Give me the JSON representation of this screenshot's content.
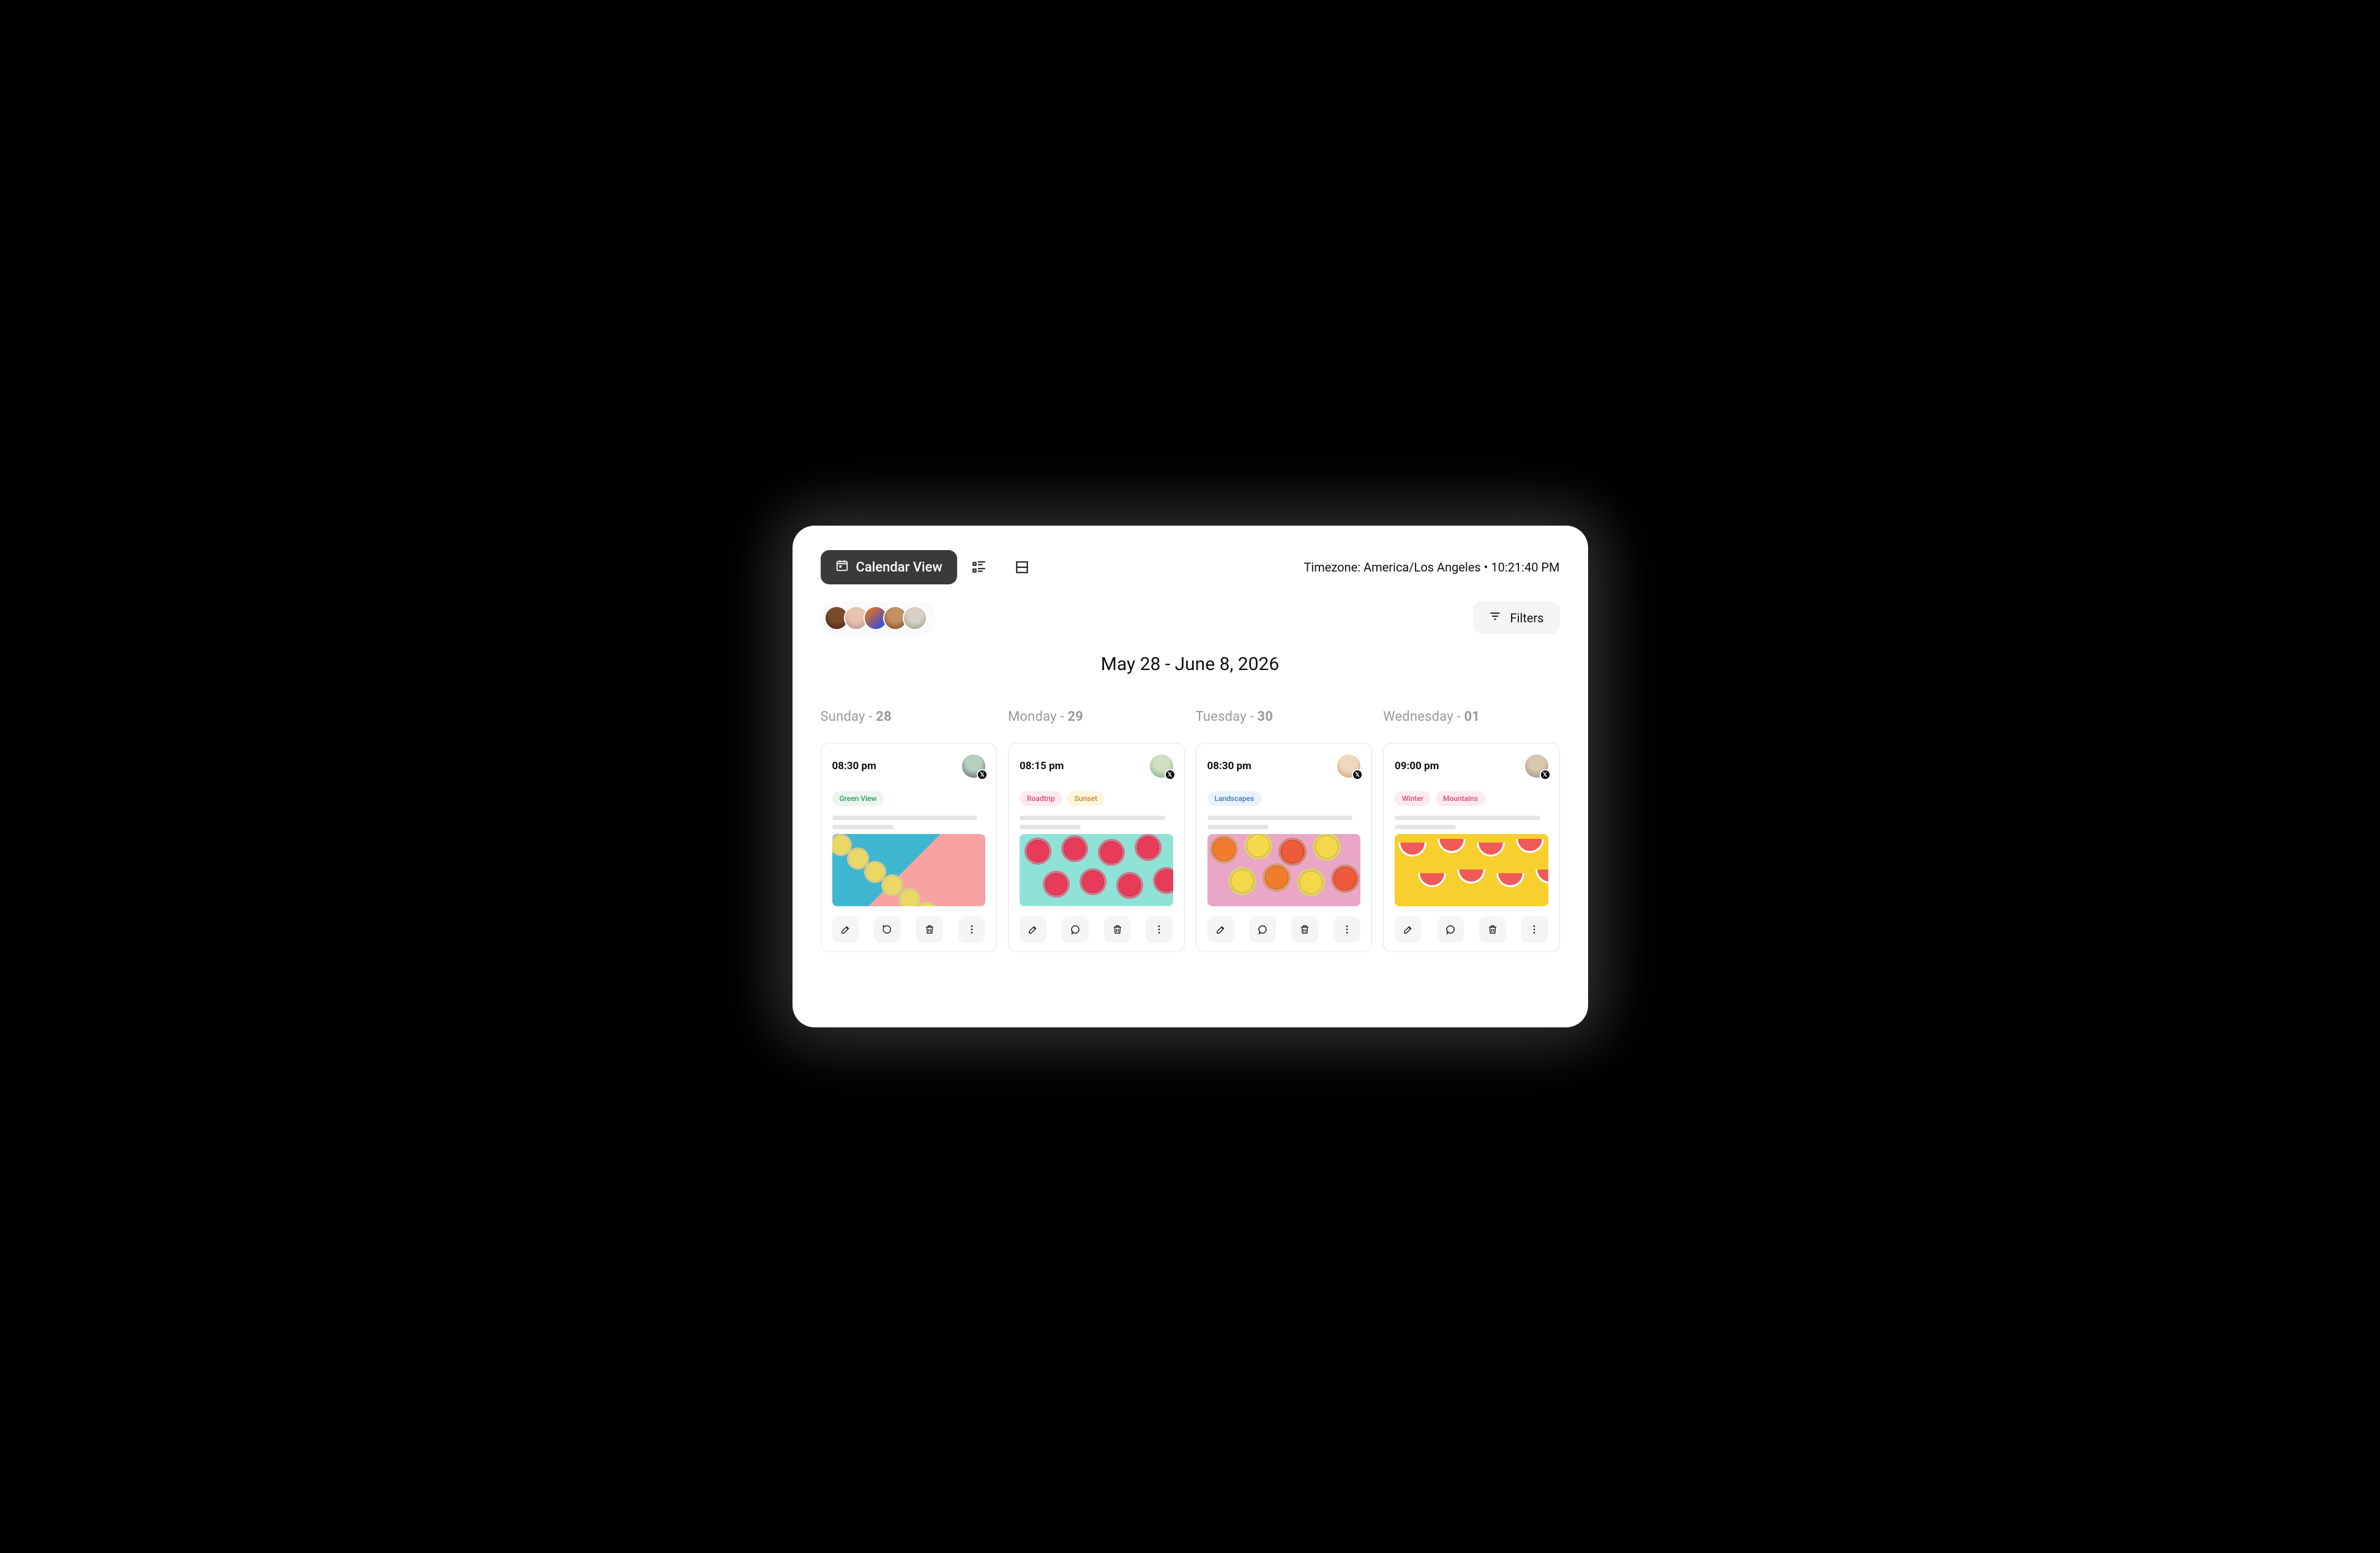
{
  "topbar": {
    "active_view_label": "Calendar View",
    "timezone_label": "Timezone:",
    "timezone_value": "America/Los Angeles",
    "time_value": "10:21:40 PM"
  },
  "filters_label": "Filters",
  "date_range": "May 28  - June 8, 2026",
  "tag_colors": {
    "green": {
      "bg": "#eaf6ef",
      "fg": "#2a9d5a"
    },
    "pink": {
      "bg": "#fdeaf0",
      "fg": "#d64b7b"
    },
    "amber": {
      "bg": "#fff4df",
      "fg": "#c98a1a"
    },
    "blue": {
      "bg": "#e9f2fb",
      "fg": "#3b7bbd"
    }
  },
  "columns": [
    {
      "weekday": "Sunday",
      "daynum": "28",
      "card": {
        "time": "08:30 pm",
        "tags": [
          {
            "label": "Green View",
            "color": "green"
          }
        ]
      }
    },
    {
      "weekday": "Monday",
      "daynum": "29",
      "card": {
        "time": "08:15 pm",
        "tags": [
          {
            "label": "Roadtrip",
            "color": "pink"
          },
          {
            "label": "Sunset",
            "color": "amber"
          }
        ]
      }
    },
    {
      "weekday": "Tuesday",
      "daynum": "30",
      "card": {
        "time": "08:30 pm",
        "tags": [
          {
            "label": "Landscapes",
            "color": "blue"
          }
        ]
      }
    },
    {
      "weekday": "Wednesday",
      "daynum": "01",
      "card": {
        "time": "09:00 pm",
        "tags": [
          {
            "label": "Winter",
            "color": "pink"
          },
          {
            "label": "Mountains",
            "color": "pink"
          }
        ]
      }
    }
  ]
}
